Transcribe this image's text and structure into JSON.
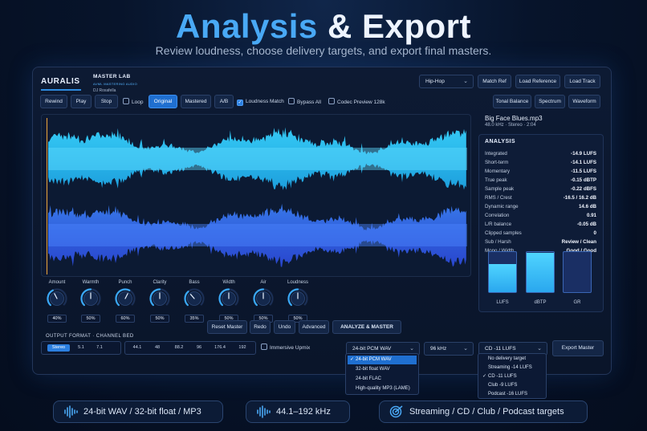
{
  "hero": {
    "title_accent": "Analysis",
    "title_rest": "& Export",
    "subtitle": "Review loudness, choose delivery targets, and export final masters."
  },
  "app": {
    "brand": "AURALIS",
    "module_title": "MASTER LAB",
    "module_subtitle": "AI/ML MASTERING AUDIO",
    "user": "DJ Roxafella"
  },
  "toolbar_top": {
    "genre": "Hip-Hop",
    "match_ref": "Match Ref",
    "load_reference": "Load Reference",
    "load_track": "Load Track"
  },
  "transport": {
    "rewind": "Rewind",
    "play": "Play",
    "stop": "Stop",
    "loop": "Loop",
    "original": "Original",
    "mastered": "Mastered",
    "ab": "A/B",
    "loudness_match": "Loudness Match",
    "bypass_all": "Bypass All",
    "codec_preview": "Codec Preview 128k"
  },
  "view_tabs": {
    "tonal_balance": "Tonal Balance",
    "spectrum": "Spectrum",
    "waveform": "Waveform"
  },
  "track": {
    "file": "Big Face Blues.mp3",
    "meta": "48.0 kHz  ·  Stereo  ·  2:04"
  },
  "analysis": {
    "title": "ANALYSIS",
    "rows": [
      {
        "label": "Integrated",
        "value": "-14.9 LUFS"
      },
      {
        "label": "Short-term",
        "value": "-14.1 LUFS"
      },
      {
        "label": "Momentary",
        "value": "-11.5 LUFS"
      },
      {
        "label": "True peak",
        "value": "-0.15 dBTP"
      },
      {
        "label": "Sample peak",
        "value": "-0.22 dBFS"
      },
      {
        "label": "RMS / Crest",
        "value": "-16.5 / 16.2 dB"
      },
      {
        "label": "Dynamic range",
        "value": "14.6 dB"
      },
      {
        "label": "Correlation",
        "value": "0.91"
      },
      {
        "label": "L/R balance",
        "value": "-0.05 dB"
      },
      {
        "label": "Clipped samples",
        "value": "0"
      },
      {
        "label": "Sub / Harsh",
        "value": "Review / Clean"
      },
      {
        "label": "Mono / Width",
        "value": "Good / Good"
      }
    ],
    "meters": [
      {
        "label": "LUFS",
        "level": 0.71
      },
      {
        "label": "dBTP",
        "level": 0.99
      },
      {
        "label": "GR",
        "level": 0.0
      }
    ]
  },
  "knobs": [
    {
      "label": "Amount",
      "value": "40%",
      "level": 0.4
    },
    {
      "label": "Warmth",
      "value": "50%",
      "level": 0.5
    },
    {
      "label": "Punch",
      "value": "60%",
      "level": 0.6
    },
    {
      "label": "Clarity",
      "value": "50%",
      "level": 0.5
    },
    {
      "label": "Bass",
      "value": "35%",
      "level": 0.35
    },
    {
      "label": "Width",
      "value": "50%",
      "level": 0.5
    },
    {
      "label": "Air",
      "value": "50%",
      "level": 0.5
    },
    {
      "label": "Loudness",
      "value": "50%",
      "level": 0.5
    }
  ],
  "actions": {
    "reset_master": "Reset Master",
    "redo": "Redo",
    "undo": "Undo",
    "advanced": "Advanced",
    "analyze_master": "ANALYZE & MASTER"
  },
  "output": {
    "label": "OUTPUT FORMAT · CHANNEL BED",
    "channels": [
      "Stereo",
      "5.1",
      "7.1"
    ],
    "channel_selected": "Stereo",
    "rates": [
      "44.1",
      "48",
      "88.2",
      "96",
      "176.4",
      "192"
    ],
    "immersive_upmix": "Immersive Upmix",
    "format_selected": "24-bit PCM WAV",
    "format_options": [
      "24-bit PCM WAV",
      "32-bit float WAV",
      "24-bit FLAC",
      "High-quality MP3 (LAME)"
    ],
    "rate_selected": "96 kHz",
    "target_selected": "CD -11 LUFS",
    "target_options": [
      {
        "name": "No delivery target",
        "value": ""
      },
      {
        "name": "Streaming",
        "value": "-14 LUFS"
      },
      {
        "name": "CD",
        "value": "-11 LUFS"
      },
      {
        "name": "Club",
        "value": "-9 LUFS"
      },
      {
        "name": "Podcast",
        "value": "-16 LUFS"
      }
    ],
    "export_master": "Export Master"
  },
  "pills": {
    "formats": "24-bit WAV / 32-bit float / MP3",
    "rates": "44.1–192 kHz",
    "targets": "Streaming / CD / Club / Podcast targets"
  },
  "colors": {
    "accent": "#49a9f5",
    "active_button": "#1f6fd0",
    "wave_top": "#2ec9f5",
    "wave_bottom": "#2f63e6",
    "playhead": "#f0a63b"
  }
}
